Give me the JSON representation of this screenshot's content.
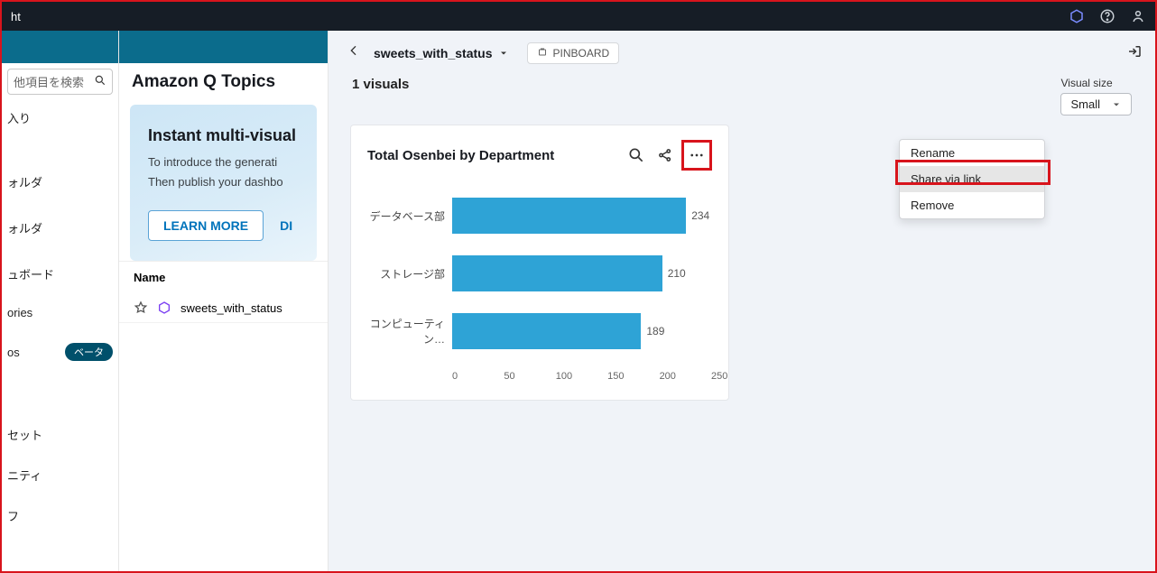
{
  "topbar": {
    "brand_fragment": "ht"
  },
  "leftnav": {
    "search_placeholder": "他項目を検索",
    "items": [
      "入り",
      "ォルダ",
      "ォルダ",
      "ュボード",
      "ories",
      "os",
      "セット",
      "ニティ",
      "フ"
    ],
    "beta_label": "ベータ"
  },
  "mid": {
    "title": "Amazon Q Topics",
    "hero_title": "Instant multi-visual",
    "hero_line1": "To introduce the generati",
    "hero_line2": "Then publish your dashbo",
    "learn_more": "LEARN MORE",
    "dismiss": "DI",
    "list_header": "Name",
    "list_item": "sweets_with_status"
  },
  "main": {
    "breadcrumb": "sweets_with_status",
    "pinboard": "PINBOARD",
    "visuals_count": "1 visuals",
    "visual_size_label": "Visual size",
    "visual_size_value": "Small",
    "card_title": "Total Osenbei by Department",
    "menu": {
      "rename": "Rename",
      "share": "Share via link",
      "remove": "Remove"
    }
  },
  "chart_data": {
    "type": "bar",
    "categories": [
      "データベース部",
      "ストレージ部",
      "コンピューティン…"
    ],
    "values": [
      234,
      210,
      189
    ],
    "xlabel": "",
    "ylabel": "",
    "title": "Total Osenbei by Department",
    "xticks": [
      0,
      50,
      100,
      150,
      200,
      250
    ],
    "xlim": [
      0,
      260
    ]
  }
}
